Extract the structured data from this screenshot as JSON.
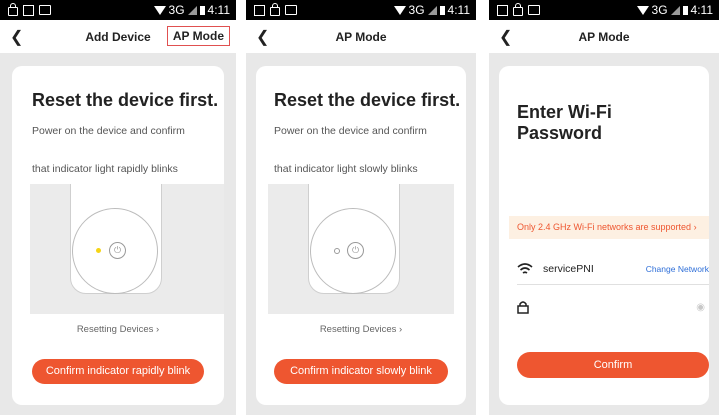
{
  "status": {
    "network": "3G",
    "time": "4:11"
  },
  "screen1": {
    "nav_title": "Add Device",
    "ap_mode_link": "AP Mode",
    "title": "Reset the device first.",
    "text1": "Power on the device and confirm",
    "text2": "that indicator light rapidly blinks",
    "resetting_link": "Resetting Devices",
    "confirm_button": "Confirm indicator rapidly blink",
    "indicator_color": "#f5d416"
  },
  "screen2": {
    "nav_title": "AP Mode",
    "title": "Reset the device first.",
    "text1": "Power on the device and confirm",
    "text2": "that indicator light slowly blinks",
    "resetting_link": "Resetting Devices",
    "confirm_button": "Confirm indicator slowly blink",
    "indicator_color": "#ffffff"
  },
  "screen3": {
    "nav_title": "AP Mode",
    "title": "Enter Wi-Fi Password",
    "warning": "Only 2.4 GHz Wi-Fi networks are supported",
    "ssid": "servicePNI",
    "change_network": "Change Network",
    "confirm_button": "Confirm"
  },
  "accent_color": "#ee5630",
  "icons": [
    "back-arrow-icon",
    "power-icon",
    "wifi-icon",
    "lock-icon",
    "eye-icon",
    "chevron-right-icon"
  ]
}
